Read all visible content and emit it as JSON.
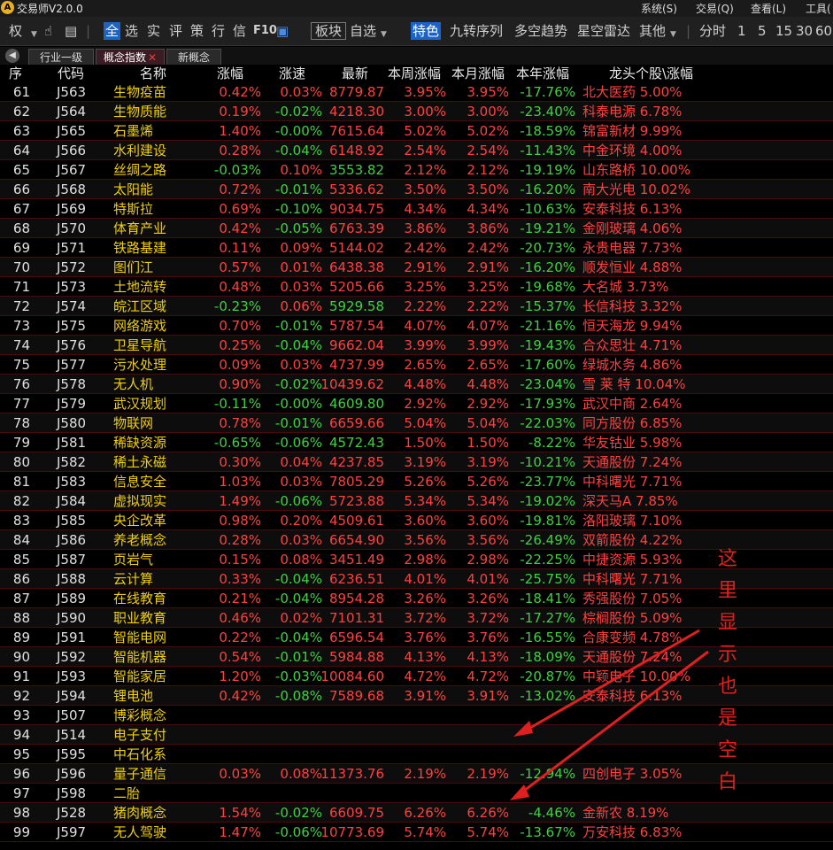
{
  "app": {
    "title": "交易师V2.0.0",
    "logo": "A"
  },
  "title_menu": [
    "系统(S)",
    "交易(Q)",
    "查看(L)",
    "工具("
  ],
  "toolbar": {
    "left_items": [
      "权"
    ],
    "icons": [
      "hand-icon",
      "grid-icon"
    ],
    "all_label": "全",
    "filters": [
      "选",
      "实",
      "评",
      "策",
      "行",
      "信"
    ],
    "f10_label": "F10",
    "board_label": "板块",
    "zixuan_label": "自选",
    "tese_label": "特色",
    "jiuzhuan_label": "九转序列",
    "duokong_label": "多空趋势",
    "xingkong_label": "星空雷达",
    "qita_label": "其他",
    "fenshi_label": "分时",
    "periods": [
      "1",
      "5",
      "15",
      "30",
      "60"
    ]
  },
  "tabs": [
    {
      "label": "行业一级",
      "active": false
    },
    {
      "label": "概念指数",
      "active": true,
      "close": "✕"
    },
    {
      "label": "新概念",
      "active": false
    }
  ],
  "columns": [
    "序",
    "代码",
    "名称",
    "涨幅",
    "涨速",
    "最新",
    "本周涨幅",
    "本月涨幅",
    "本年涨幅",
    "龙头个股\\涨幅"
  ],
  "rows": [
    {
      "seq": "61",
      "code": "J563",
      "name": "生物疫苗",
      "chg": "0.42%",
      "spd": "0.03%",
      "last": "8779.87",
      "week": "3.95%",
      "month": "3.95%",
      "year": "-17.76%",
      "leader": "北大医药 5.00%"
    },
    {
      "seq": "62",
      "code": "J564",
      "name": "生物质能",
      "chg": "0.19%",
      "spd": "-0.02%",
      "last": "4218.30",
      "week": "3.00%",
      "month": "3.00%",
      "year": "-23.40%",
      "leader": "科泰电源 6.78%"
    },
    {
      "seq": "63",
      "code": "J565",
      "name": "石墨烯",
      "chg": "1.40%",
      "spd": "-0.00%",
      "last": "7615.64",
      "week": "5.02%",
      "month": "5.02%",
      "year": "-18.59%",
      "leader": "锦富新材 9.99%"
    },
    {
      "seq": "64",
      "code": "J566",
      "name": "水利建设",
      "chg": "0.28%",
      "spd": "-0.04%",
      "last": "6148.92",
      "week": "2.54%",
      "month": "2.54%",
      "year": "-11.43%",
      "leader": "中金环境 4.00%"
    },
    {
      "seq": "65",
      "code": "J567",
      "name": "丝绸之路",
      "chg": "-0.03%",
      "spd": "0.10%",
      "last": "3553.82",
      "week": "2.12%",
      "month": "2.12%",
      "year": "-19.19%",
      "leader": "山东路桥 10.00%"
    },
    {
      "seq": "66",
      "code": "J568",
      "name": "太阳能",
      "chg": "0.72%",
      "spd": "-0.01%",
      "last": "5336.62",
      "week": "3.50%",
      "month": "3.50%",
      "year": "-16.20%",
      "leader": "南大光电 10.02%"
    },
    {
      "seq": "67",
      "code": "J569",
      "name": "特斯拉",
      "chg": "0.69%",
      "spd": "-0.10%",
      "last": "9034.75",
      "week": "4.34%",
      "month": "4.34%",
      "year": "-10.63%",
      "leader": "安泰科技 6.13%"
    },
    {
      "seq": "68",
      "code": "J570",
      "name": "体育产业",
      "chg": "0.42%",
      "spd": "-0.05%",
      "last": "6763.39",
      "week": "3.86%",
      "month": "3.86%",
      "year": "-19.21%",
      "leader": "金刚玻璃 4.06%"
    },
    {
      "seq": "69",
      "code": "J571",
      "name": "铁路基建",
      "chg": "0.11%",
      "spd": "0.09%",
      "last": "5144.02",
      "week": "2.42%",
      "month": "2.42%",
      "year": "-20.73%",
      "leader": "永贵电器 7.73%"
    },
    {
      "seq": "70",
      "code": "J572",
      "name": "图们江",
      "chg": "0.57%",
      "spd": "0.01%",
      "last": "6438.38",
      "week": "2.91%",
      "month": "2.91%",
      "year": "-16.20%",
      "leader": "顺发恒业 4.88%"
    },
    {
      "seq": "71",
      "code": "J573",
      "name": "土地流转",
      "chg": "0.48%",
      "spd": "0.03%",
      "last": "5205.66",
      "week": "3.25%",
      "month": "3.25%",
      "year": "-19.68%",
      "leader": "大名城 3.73%"
    },
    {
      "seq": "72",
      "code": "J574",
      "name": "皖江区域",
      "chg": "-0.23%",
      "spd": "0.06%",
      "last": "5929.58",
      "week": "2.22%",
      "month": "2.22%",
      "year": "-15.37%",
      "leader": "长信科技 3.32%"
    },
    {
      "seq": "73",
      "code": "J575",
      "name": "网络游戏",
      "chg": "0.70%",
      "spd": "-0.01%",
      "last": "5787.54",
      "week": "4.07%",
      "month": "4.07%",
      "year": "-21.16%",
      "leader": "恒天海龙 9.94%"
    },
    {
      "seq": "74",
      "code": "J576",
      "name": "卫星导航",
      "chg": "0.25%",
      "spd": "-0.04%",
      "last": "9662.04",
      "week": "3.99%",
      "month": "3.99%",
      "year": "-19.43%",
      "leader": "合众思壮 4.71%"
    },
    {
      "seq": "75",
      "code": "J577",
      "name": "污水处理",
      "chg": "0.09%",
      "spd": "0.03%",
      "last": "4737.99",
      "week": "2.65%",
      "month": "2.65%",
      "year": "-17.60%",
      "leader": "绿城水务 4.86%"
    },
    {
      "seq": "76",
      "code": "J578",
      "name": "无人机",
      "chg": "0.90%",
      "spd": "-0.02%",
      "last": "10439.62",
      "week": "4.48%",
      "month": "4.48%",
      "year": "-23.04%",
      "leader": "雪 莱 特 10.04%"
    },
    {
      "seq": "77",
      "code": "J579",
      "name": "武汉规划",
      "chg": "-0.11%",
      "spd": "-0.00%",
      "last": "4609.80",
      "week": "2.92%",
      "month": "2.92%",
      "year": "-17.93%",
      "leader": "武汉中商 2.64%"
    },
    {
      "seq": "78",
      "code": "J580",
      "name": "物联网",
      "chg": "0.78%",
      "spd": "-0.01%",
      "last": "6659.66",
      "week": "5.04%",
      "month": "5.04%",
      "year": "-22.03%",
      "leader": "同方股份 6.85%"
    },
    {
      "seq": "79",
      "code": "J581",
      "name": "稀缺资源",
      "chg": "-0.65%",
      "spd": "-0.06%",
      "last": "4572.43",
      "week": "1.50%",
      "month": "1.50%",
      "year": "-8.22%",
      "leader": "华友钴业 5.98%"
    },
    {
      "seq": "80",
      "code": "J582",
      "name": "稀土永磁",
      "chg": "0.30%",
      "spd": "0.04%",
      "last": "4237.85",
      "week": "3.19%",
      "month": "3.19%",
      "year": "-10.21%",
      "leader": "天通股份 7.24%"
    },
    {
      "seq": "81",
      "code": "J583",
      "name": "信息安全",
      "chg": "1.03%",
      "spd": "0.03%",
      "last": "7805.29",
      "week": "5.26%",
      "month": "5.26%",
      "year": "-23.77%",
      "leader": "中科曙光 7.71%"
    },
    {
      "seq": "82",
      "code": "J584",
      "name": "虚拟现实",
      "chg": "1.49%",
      "spd": "-0.06%",
      "last": "5723.88",
      "week": "5.34%",
      "month": "5.34%",
      "year": "-19.02%",
      "leader": "深天马A 7.85%"
    },
    {
      "seq": "83",
      "code": "J585",
      "name": "央企改革",
      "chg": "0.98%",
      "spd": "0.20%",
      "last": "4509.61",
      "week": "3.60%",
      "month": "3.60%",
      "year": "-19.81%",
      "leader": "洛阳玻璃 7.10%"
    },
    {
      "seq": "84",
      "code": "J586",
      "name": "养老概念",
      "chg": "0.28%",
      "spd": "0.03%",
      "last": "6654.90",
      "week": "3.56%",
      "month": "3.56%",
      "year": "-26.49%",
      "leader": "双箭股份 4.22%"
    },
    {
      "seq": "85",
      "code": "J587",
      "name": "页岩气",
      "chg": "0.15%",
      "spd": "0.08%",
      "last": "3451.49",
      "week": "2.98%",
      "month": "2.98%",
      "year": "-22.25%",
      "leader": "中捷资源 5.93%"
    },
    {
      "seq": "86",
      "code": "J588",
      "name": "云计算",
      "chg": "0.33%",
      "spd": "-0.04%",
      "last": "6236.51",
      "week": "4.01%",
      "month": "4.01%",
      "year": "-25.75%",
      "leader": "中科曙光 7.71%"
    },
    {
      "seq": "87",
      "code": "J589",
      "name": "在线教育",
      "chg": "0.21%",
      "spd": "-0.04%",
      "last": "8954.28",
      "week": "3.26%",
      "month": "3.26%",
      "year": "-18.41%",
      "leader": "秀强股份 7.05%"
    },
    {
      "seq": "88",
      "code": "J590",
      "name": "职业教育",
      "chg": "0.46%",
      "spd": "0.02%",
      "last": "7101.31",
      "week": "3.72%",
      "month": "3.72%",
      "year": "-17.27%",
      "leader": "棕榈股份 5.09%"
    },
    {
      "seq": "89",
      "code": "J591",
      "name": "智能电网",
      "chg": "0.22%",
      "spd": "-0.04%",
      "last": "6596.54",
      "week": "3.76%",
      "month": "3.76%",
      "year": "-16.55%",
      "leader": "合康变频 4.78%"
    },
    {
      "seq": "90",
      "code": "J592",
      "name": "智能机器",
      "chg": "0.54%",
      "spd": "-0.01%",
      "last": "5984.88",
      "week": "4.13%",
      "month": "4.13%",
      "year": "-18.09%",
      "leader": "天通股份 7.24%"
    },
    {
      "seq": "91",
      "code": "J593",
      "name": "智能家居",
      "chg": "1.20%",
      "spd": "-0.03%",
      "last": "10084.60",
      "week": "4.72%",
      "month": "4.72%",
      "year": "-20.87%",
      "leader": "中颖电子 10.00%"
    },
    {
      "seq": "92",
      "code": "J594",
      "name": "锂电池",
      "chg": "0.42%",
      "spd": "-0.08%",
      "last": "7589.68",
      "week": "3.91%",
      "month": "3.91%",
      "year": "-13.02%",
      "leader": "安泰科技 6.13%"
    },
    {
      "seq": "93",
      "code": "J507",
      "name": "博彩概念",
      "chg": "",
      "spd": "",
      "last": "",
      "week": "",
      "month": "",
      "year": "",
      "leader": ""
    },
    {
      "seq": "94",
      "code": "J514",
      "name": "电子支付",
      "chg": "",
      "spd": "",
      "last": "",
      "week": "",
      "month": "",
      "year": "",
      "leader": ""
    },
    {
      "seq": "95",
      "code": "J595",
      "name": "中石化系",
      "chg": "",
      "spd": "",
      "last": "",
      "week": "",
      "month": "",
      "year": "",
      "leader": ""
    },
    {
      "seq": "96",
      "code": "J596",
      "name": "量子通信",
      "chg": "0.03%",
      "spd": "0.08%",
      "last": "11373.76",
      "week": "2.19%",
      "month": "2.19%",
      "year": "-12.94%",
      "leader": "四创电子 3.05%"
    },
    {
      "seq": "97",
      "code": "J598",
      "name": "二胎",
      "chg": "",
      "spd": "",
      "last": "",
      "week": "",
      "month": "",
      "year": "",
      "leader": ""
    },
    {
      "seq": "98",
      "code": "J528",
      "name": "猪肉概念",
      "chg": "1.54%",
      "spd": "-0.02%",
      "last": "6609.75",
      "week": "6.26%",
      "month": "6.26%",
      "year": "-4.46%",
      "leader": "金新农 8.19%"
    },
    {
      "seq": "99",
      "code": "J597",
      "name": "无人驾驶",
      "chg": "1.47%",
      "spd": "-0.06%",
      "last": "10773.69",
      "week": "5.74%",
      "month": "5.74%",
      "year": "-13.67%",
      "leader": "万安科技 6.83%"
    }
  ],
  "annotation": {
    "text": [
      "这",
      "里",
      "显",
      "示",
      "也",
      "是",
      "空",
      "白"
    ],
    "color": "#e02020"
  },
  "colors": {
    "up": "#ff4040",
    "down": "#40d040",
    "name": "#f2d000",
    "background": "#000000",
    "accent": "#1c63c8"
  }
}
